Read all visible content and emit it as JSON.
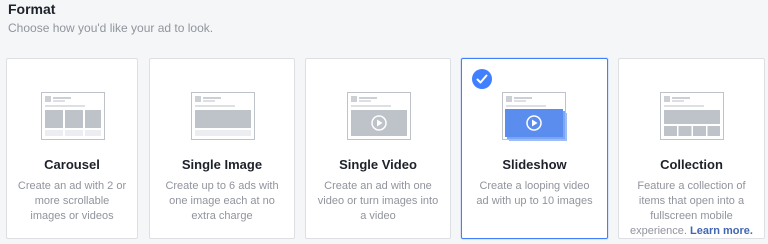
{
  "header": {
    "title": "Format",
    "subtitle": "Choose how you'd like your ad to look."
  },
  "formats": [
    {
      "title": "Carousel",
      "description": "Create an ad with 2 or more scrollable images or videos",
      "selected": false
    },
    {
      "title": "Single Image",
      "description": "Create up to 6 ads with one image each at no extra charge",
      "selected": false
    },
    {
      "title": "Single Video",
      "description": "Create an ad with one video or turn images into a video",
      "selected": false
    },
    {
      "title": "Slideshow",
      "description": "Create a looping video ad with up to 10 images",
      "selected": true
    },
    {
      "title": "Collection",
      "description": "Feature a collection of items that open into a fullscreen mobile experience.",
      "link_text": "Learn more.",
      "selected": false
    }
  ],
  "colors": {
    "selected_border": "#4080ff",
    "slideshow_fill": "#5b8def",
    "link": "#4267b2"
  }
}
